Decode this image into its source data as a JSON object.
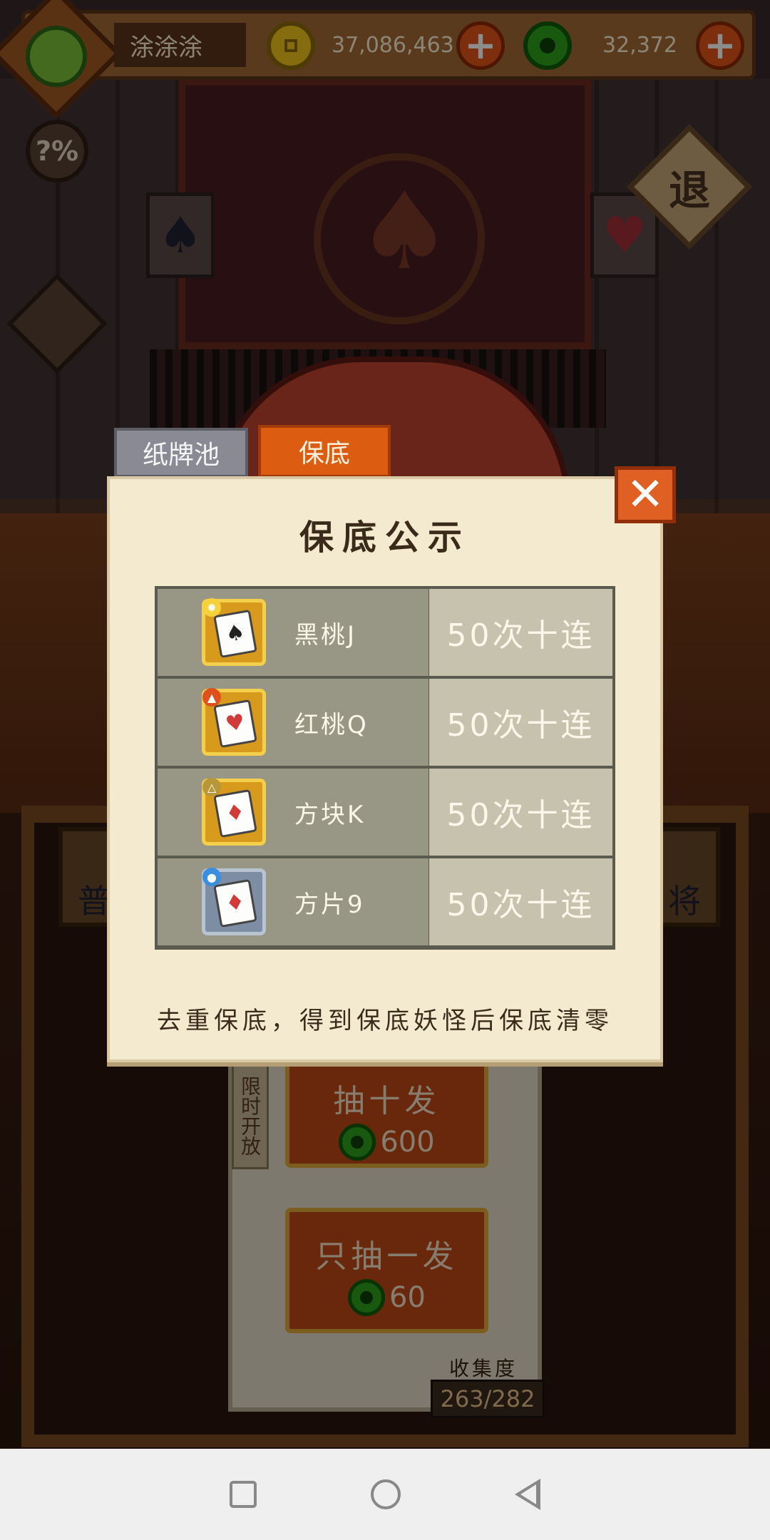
{
  "topbar": {
    "username": "涂涂涂",
    "gold_amount": "37,086,463",
    "jade_amount": "32,372"
  },
  "side": {
    "odds_label": "?%",
    "exit_label": "退"
  },
  "tabs": [
    {
      "label": "纸牌池"
    },
    {
      "label": "保底"
    }
  ],
  "dialog": {
    "title": "保底公示",
    "rows": [
      {
        "name": "黑桃J",
        "value": "50次十连",
        "suit": "♠",
        "rarity": "gold"
      },
      {
        "name": "红桃Q",
        "value": "50次十连",
        "suit": "♥",
        "rarity": "gold"
      },
      {
        "name": "方块K",
        "value": "50次十连",
        "suit": "♦",
        "rarity": "gold"
      },
      {
        "name": "方片9",
        "value": "50次十连",
        "suit": "♦",
        "rarity": "silver"
      }
    ],
    "note": "去重保底，得到保底妖怪后保底清零"
  },
  "panel": {
    "limited_label": "限时开放",
    "ten_draw_label": "抽十发",
    "ten_draw_cost": "600",
    "single_draw_label": "只抽一发",
    "single_draw_cost": "60",
    "collection_label": "收集度",
    "collection_value": "263/282",
    "side_left_label": "普",
    "side_right_label": "将"
  },
  "colors": {
    "accent": "#dc5d12",
    "jade": "#2ea21c",
    "gold": "#f2c51c"
  }
}
